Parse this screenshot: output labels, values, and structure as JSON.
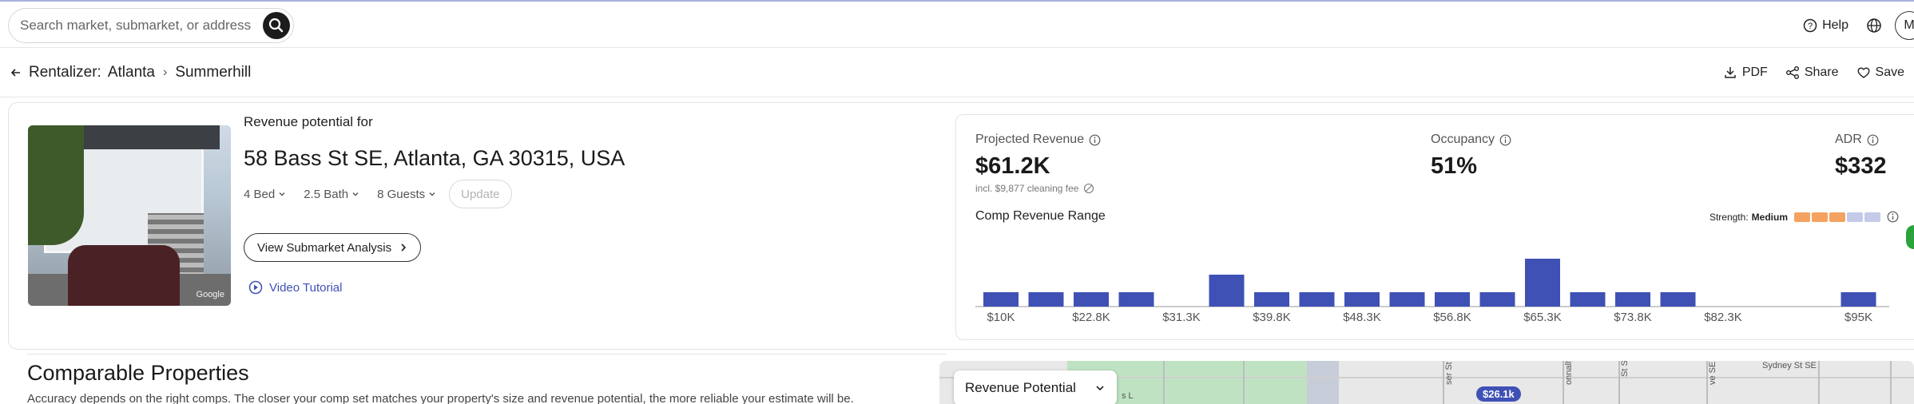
{
  "search": {
    "placeholder": "Search market, submarket, or address"
  },
  "topbar": {
    "help_label": "Help",
    "avatar_initial": "M"
  },
  "breadcrumb": {
    "root": "Rentalizer:",
    "market": "Atlanta",
    "submarket": "Summerhill"
  },
  "actions": {
    "pdf": "PDF",
    "share": "Share",
    "save": "Save"
  },
  "photo": {
    "watermark": "Google"
  },
  "property": {
    "revenue_label": "Revenue potential for",
    "address": "58 Bass St SE, Atlanta, GA 30315, USA",
    "beds": "4 Bed",
    "baths": "2.5 Bath",
    "guests": "8 Guests",
    "update_label": "Update",
    "submarket_button": "View Submarket Analysis",
    "video_label": "Video Tutorial"
  },
  "metrics": {
    "projected_revenue": {
      "label": "Projected Revenue",
      "value": "$61.2K",
      "note": "incl. $9,877 cleaning fee"
    },
    "occupancy": {
      "label": "Occupancy",
      "value": "51%"
    },
    "adr": {
      "label": "ADR",
      "value": "$332"
    }
  },
  "comp_range": {
    "title": "Comp Revenue Range",
    "strength_label": "Strength:",
    "strength_value": "Medium",
    "strength_colors": [
      "#f4a261",
      "#f4a261",
      "#f4a261",
      "#c5cae9",
      "#c5cae9"
    ]
  },
  "chart_data": {
    "type": "bar",
    "tick_labels": [
      "$10K",
      "$22.8K",
      "$31.3K",
      "$39.8K",
      "$48.3K",
      "$56.8K",
      "$65.3K",
      "$73.8K",
      "$82.3K",
      "$95K"
    ],
    "values": [
      1,
      1,
      1,
      1,
      0,
      2,
      1,
      1,
      1,
      1,
      1,
      1,
      3,
      1,
      1,
      1,
      0,
      0,
      0,
      1
    ],
    "bar_color": "#3f51b5"
  },
  "comparables": {
    "title": "Comparable Properties",
    "subtitle": "Accuracy depends on the right comps. The closer your comp set matches your property's size and revenue potential, the more reliable your estimate will be."
  },
  "map": {
    "dropdown_label": "Revenue Potential",
    "price_pin": "$26.1k",
    "street_sydney": "Sydney St SE",
    "street_fragment_1": "ser St SE",
    "street_fragment_2": "onnally St",
    "street_fragment_3": "St SE",
    "street_fragment_4": "ve SE",
    "street_fragment_5": "s L"
  }
}
